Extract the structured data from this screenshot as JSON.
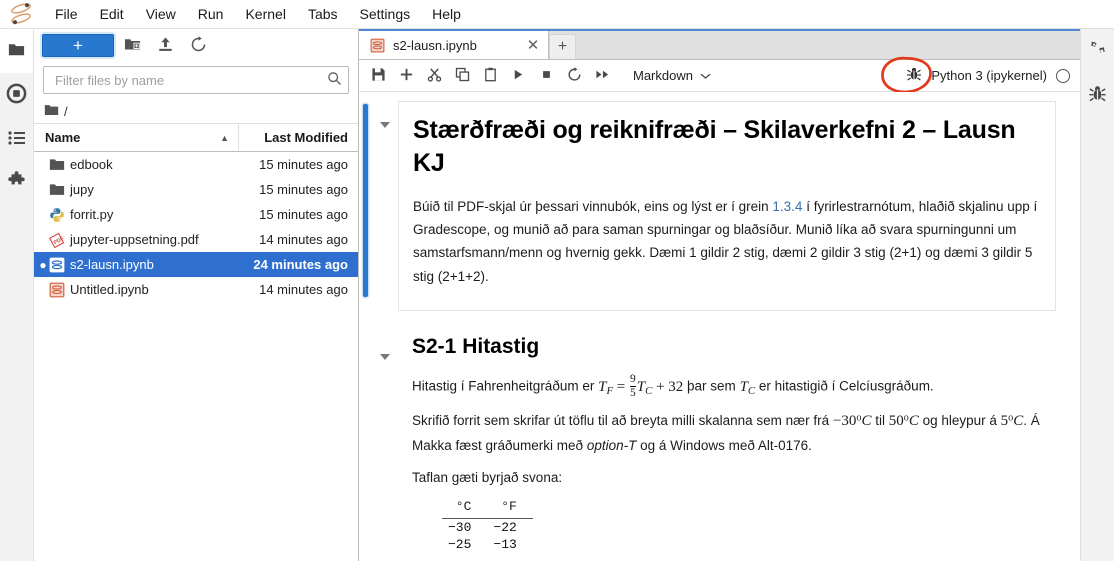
{
  "menu": {
    "logo_icon": "jupyter-logo",
    "items": [
      "File",
      "Edit",
      "View",
      "Run",
      "Kernel",
      "Tabs",
      "Settings",
      "Help"
    ]
  },
  "activity_left": {
    "items": [
      {
        "name": "file-browser",
        "icon": "folder-icon",
        "active": true
      },
      {
        "name": "running-terminals",
        "icon": "running-circle-icon",
        "active": false
      },
      {
        "name": "commands",
        "icon": "list-icon",
        "active": false
      },
      {
        "name": "extensions",
        "icon": "puzzle-icon",
        "active": false
      }
    ]
  },
  "activity_right": {
    "items": [
      {
        "name": "property-inspector",
        "icon": "gears-icon"
      },
      {
        "name": "debugger",
        "icon": "bug-icon"
      }
    ]
  },
  "file_browser": {
    "toolbar": {
      "new_launcher_label": "+",
      "new_folder_icon": "new-folder-icon",
      "upload_icon": "upload-icon",
      "refresh_icon": "refresh-icon"
    },
    "filter": {
      "placeholder": "Filter files by name",
      "value": "",
      "icon": "search-icon"
    },
    "breadcrumb": {
      "home_icon": "folder-icon",
      "path": "/"
    },
    "columns": {
      "name": "Name",
      "last_modified": "Last Modified",
      "sort_caret": "▲"
    },
    "files": [
      {
        "name": "edbook",
        "modified": "15 minutes ago",
        "icon": "folder-icon",
        "selected": false,
        "running": false
      },
      {
        "name": "jupy",
        "modified": "15 minutes ago",
        "icon": "folder-icon",
        "selected": false,
        "running": false
      },
      {
        "name": "forrit.py",
        "modified": "15 minutes ago",
        "icon": "python-icon",
        "selected": false,
        "running": false
      },
      {
        "name": "jupyter-uppsetning.pdf",
        "modified": "14 minutes ago",
        "icon": "pdf-icon",
        "selected": false,
        "running": false
      },
      {
        "name": "s2-lausn.ipynb",
        "modified": "24 minutes ago",
        "icon": "notebook-icon",
        "selected": true,
        "running": true
      },
      {
        "name": "Untitled.ipynb",
        "modified": "14 minutes ago",
        "icon": "notebook-icon",
        "selected": false,
        "running": false
      }
    ]
  },
  "dock": {
    "tab": {
      "title": "s2-lausn.ipynb",
      "icon": "notebook-icon",
      "close_icon": "close-icon"
    },
    "add_tab_label": "+"
  },
  "notebook_toolbar": {
    "buttons": [
      {
        "name": "save-button",
        "icon": "save-icon"
      },
      {
        "name": "insert-cell-button",
        "icon": "plus-icon"
      },
      {
        "name": "cut-button",
        "icon": "scissors-icon"
      },
      {
        "name": "copy-button",
        "icon": "copy-icon"
      },
      {
        "name": "paste-button",
        "icon": "clipboard-icon"
      },
      {
        "name": "run-button",
        "icon": "play-icon"
      },
      {
        "name": "interrupt-button",
        "icon": "stop-icon"
      },
      {
        "name": "restart-button",
        "icon": "restart-icon"
      },
      {
        "name": "restart-run-all-button",
        "icon": "fast-forward-icon"
      }
    ],
    "cell_type": "Markdown",
    "cell_type_caret": "chevron-down-icon",
    "debugger_icon": "bug-icon",
    "kernel_name": "Python 3 (ipykernel)",
    "kernel_status": "idle",
    "annotation": {
      "shape": "hand-drawn-ellipse",
      "color": "#e03b1c",
      "target": "debugger-icon"
    }
  },
  "notebook": {
    "cells": [
      {
        "type": "markdown",
        "selected": true,
        "heading": "Stærðfræði og reiknifræði – Skilaverkefni 2 – Lausn KJ",
        "paragraph_pre": "Búið til PDF-skjal úr þessari vinnubók, eins og lýst er í grein ",
        "paragraph_link": "1.3.4",
        "paragraph_post": " í fyrirlestrarnótum, hlaðið skjalinu upp í Gradescope, og munið að para saman spurningar og blaðsíður. Munið líka að svara spurningunni um samstarfsmann/menn og hvernig gekk. Dæmi 1 gildir 2 stig, dæmi 2 gildir 3 stig (2+1) og dæmi 3 gildir 5 stig (2+1+2)."
      },
      {
        "type": "markdown",
        "selected": false,
        "heading": "S2-1 Hitastig",
        "line1_a": "Hitastig í Fahrenheitgráðum er ",
        "math1": "T_F = 9/5 T_C + 32",
        "line1_b": " þar sem ",
        "math2": "T_C",
        "line1_c": " er hitastigið í Celcíusgráðum.",
        "line2_a": "Skrifið forrit sem skrifar út töflu til að breyta milli skalanna sem nær frá ",
        "math3": "-30°C",
        "line2_b": " til ",
        "math4": "50°C",
        "line2_c": " og hleypur á ",
        "math5": "5°C",
        "line2_d": ". Á Makka fæst gráðumerki með ",
        "line2_em": "option-T",
        "line2_e": " og á Windows með Alt-0176.",
        "line3": "Taflan gæti byrjað svona:",
        "table": {
          "headers": [
            "°C",
            "°F"
          ],
          "rows": [
            [
              "−30",
              "−22"
            ],
            [
              "−25",
              "−13"
            ]
          ]
        }
      }
    ]
  },
  "colors": {
    "accent_blue": "#2878d0",
    "selection_blue": "#2f6fd0",
    "annotation_red": "#e03b1c",
    "link_blue": "#3a6fb0"
  }
}
